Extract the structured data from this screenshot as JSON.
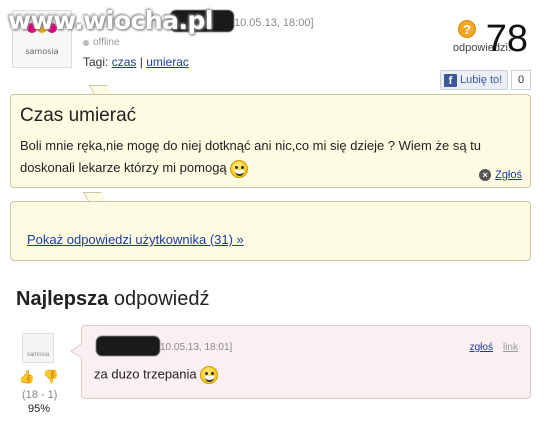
{
  "site": {
    "watermark": "www.wiocha.pl"
  },
  "question": {
    "avatar_text": "samosia",
    "date": "10.05.13, 18:00]",
    "status": "offline",
    "tags_label": "Tagi:",
    "tags": [
      "czas",
      "umierac"
    ],
    "tag_separator": "|",
    "title": "Czas umierać",
    "body": "Boli mnie ręka,nie mogę do niej dotknąć ani nic,co mi się dzieje ? Wiem że są tu doskonali lekarze którzy mi pomogą",
    "report_label": "Zgłoś"
  },
  "answers": {
    "label": "odpowiedzi:",
    "count": "78",
    "icon": "question-icon"
  },
  "facebook": {
    "like_label": "Lubię to!",
    "count": "0"
  },
  "user_answers": {
    "link_label": "Pokaż odpowiedzi użytkownika (31) »"
  },
  "best_answer": {
    "heading_bold": "Najlepsza",
    "heading_rest": " odpowiedź",
    "avatar_text": "samosia",
    "date": "10.05.13, 18:01]",
    "report_label": "zgłoś",
    "link_label": "link",
    "body": "za duzo trzepania",
    "votes": "(18 - 1)",
    "percent": "95%"
  },
  "colors": {
    "question_bg": "#fefbe3",
    "answer_bg": "#fbf0f1",
    "link": "#1a3aa6"
  }
}
